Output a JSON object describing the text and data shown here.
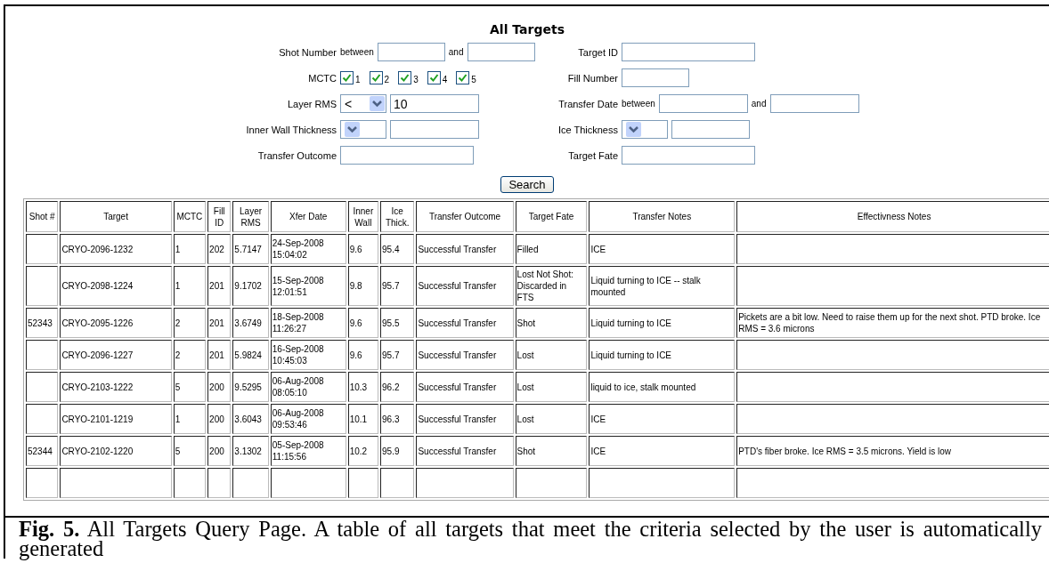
{
  "title": "All Targets",
  "form": {
    "left": [
      {
        "kind": "range",
        "label": "Shot Number",
        "between": "between",
        "and": "and"
      },
      {
        "kind": "checkboxes",
        "label": "MCTC",
        "options": [
          {
            "label": "1",
            "checked": true
          },
          {
            "label": "2",
            "checked": true
          },
          {
            "label": "3",
            "checked": true
          },
          {
            "label": "4",
            "checked": true
          },
          {
            "label": "5",
            "checked": true
          }
        ]
      },
      {
        "kind": "select_text",
        "label": "Layer RMS",
        "select": "<",
        "value": "10"
      },
      {
        "kind": "select_text",
        "label": "Inner Wall Thickness"
      },
      {
        "kind": "text",
        "label": "Transfer Outcome"
      }
    ],
    "right": [
      {
        "kind": "text",
        "label": "Target ID"
      },
      {
        "kind": "text",
        "label": "Fill Number"
      },
      {
        "kind": "range",
        "label": "Transfer Date",
        "between": "between",
        "and": "and"
      },
      {
        "kind": "select_text",
        "label": "Ice Thickness"
      },
      {
        "kind": "text",
        "label": "Target Fate"
      }
    ]
  },
  "search_button": "Search",
  "table": {
    "columns": [
      "Shot #",
      "Target",
      "MCTC",
      "Fill ID",
      "Layer RMS",
      "Xfer Date",
      "Inner Wall",
      "Ice Thick.",
      "Transfer Outcome",
      "Target Fate",
      "Transfer Notes",
      "Effectivness Notes"
    ],
    "rows": [
      [
        "",
        "CRYO-2096-1232",
        "1",
        "202",
        "5.7147",
        "24-Sep-2008 15:04:02",
        "9.6",
        "95.4",
        "Successful Transfer",
        "Filled",
        "ICE",
        ""
      ],
      [
        "",
        "CRYO-2098-1224",
        "1",
        "201",
        "9.1702",
        "15-Sep-2008 12:01:51",
        "9.8",
        "95.7",
        "Successful Transfer",
        "Lost Not Shot: Discarded in FTS",
        "Liquid turning to ICE -- stalk mounted",
        ""
      ],
      [
        "52343",
        "CRYO-2095-1226",
        "2",
        "201",
        "3.6749",
        "18-Sep-2008 11:26:27",
        "9.6",
        "95.5",
        "Successful Transfer",
        "Shot",
        "Liquid turning to ICE",
        "Pickets are a bit low. Need to raise them up for the next shot. PTD broke. Ice RMS = 3.6 microns"
      ],
      [
        "",
        "CRYO-2096-1227",
        "2",
        "201",
        "5.9824",
        "16-Sep-2008 10:45:03",
        "9.6",
        "95.7",
        "Successful Transfer",
        "Lost",
        "Liquid turning to ICE",
        ""
      ],
      [
        "",
        "CRYO-2103-1222",
        "5",
        "200",
        "9.5295",
        "06-Aug-2008 08:05:10",
        "10.3",
        "96.2",
        "Successful Transfer",
        "Lost",
        "liquid to ice, stalk mounted",
        ""
      ],
      [
        "",
        "CRYO-2101-1219",
        "1",
        "200",
        "3.6043",
        "06-Aug-2008 09:53:46",
        "10.1",
        "96.3",
        "Successful Transfer",
        "Lost",
        "ICE",
        ""
      ],
      [
        "52344",
        "CRYO-2102-1220",
        "5",
        "200",
        "3.1302",
        "05-Sep-2008 11:15:56",
        "10.2",
        "95.9",
        "Successful Transfer",
        "Shot",
        "ICE",
        "PTD's fiber broke. Ice RMS = 3.5 microns. Yield is low"
      ]
    ]
  },
  "caption": "**Fig. 5.** All Targets Query Page. A table of all targets that meet the criteria selected by the user is automatically generated"
}
